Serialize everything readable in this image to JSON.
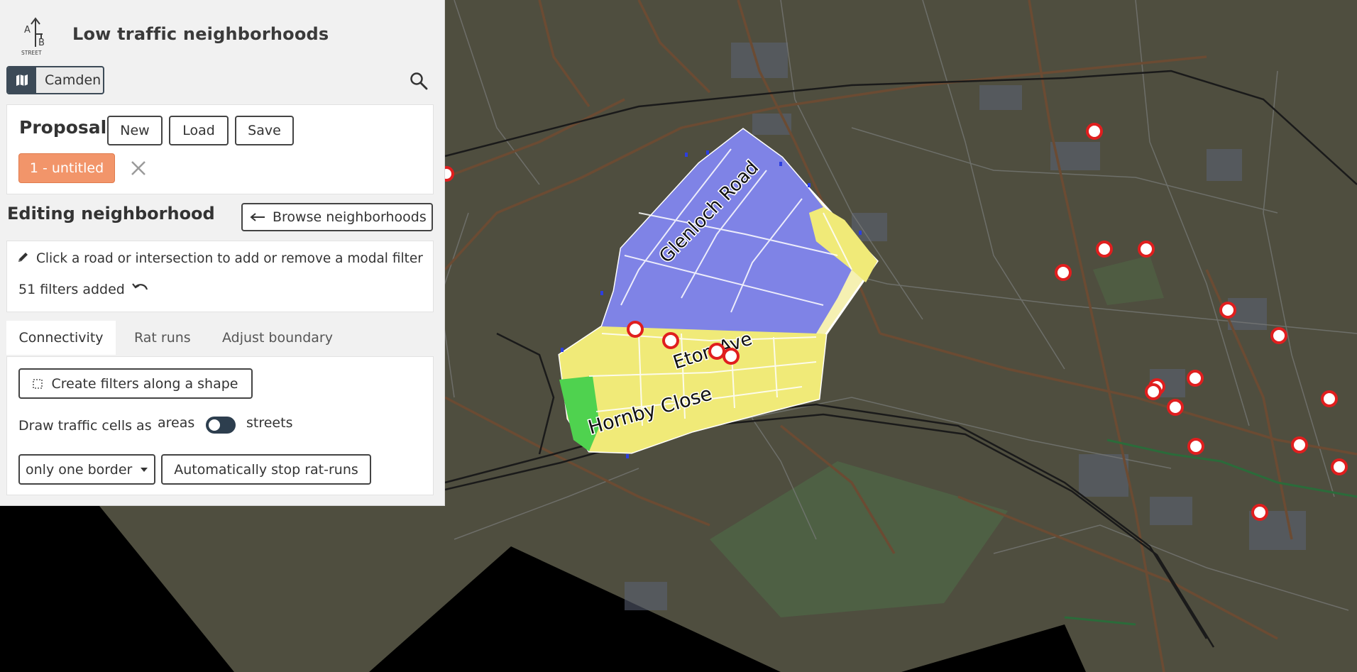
{
  "app": {
    "title": "Low traffic neighborhoods",
    "logo_text": {
      "a": "A",
      "b": "B",
      "street": "STREET"
    }
  },
  "region": {
    "label": "Camden",
    "icon": "map-icon"
  },
  "search": {
    "icon": "search-icon"
  },
  "proposals": {
    "title": "Proposals",
    "new_label": "New",
    "load_label": "Load",
    "save_label": "Save",
    "current": "1 - untitled"
  },
  "editing": {
    "title": "Editing neighborhood",
    "browse_label": "Browse neighborhoods",
    "hint": "Click a road or intersection to add or remove a modal filter",
    "filters_added": "51 filters added"
  },
  "tabs": [
    {
      "label": "Connectivity",
      "active": true
    },
    {
      "label": "Rat runs",
      "active": false
    },
    {
      "label": "Adjust boundary",
      "active": false
    }
  ],
  "connectivity": {
    "create_filters_label": "Create filters along a shape",
    "draw_label": "Draw traffic cells as",
    "areas_label": "areas",
    "streets_label": "streets",
    "border_select": "only one border",
    "stop_ratruns_label": "Automatically stop rat-runs"
  },
  "map": {
    "road_labels": [
      "Glenloch Road",
      "Eton Ave",
      "Hornby Close"
    ],
    "colors": {
      "background": "#4f4e3f",
      "cell_blue": "#7f83e6",
      "cell_yellow": "#f0ea78",
      "cell_green": "#4fd24f",
      "road": "#6b4b33",
      "rail": "#1a1a1a",
      "filter_marker": "#e01e1e"
    }
  },
  "colors": {
    "accent": "#f2956a",
    "panel_bg": "#f1f1f1",
    "dark": "#2d3e4e"
  }
}
